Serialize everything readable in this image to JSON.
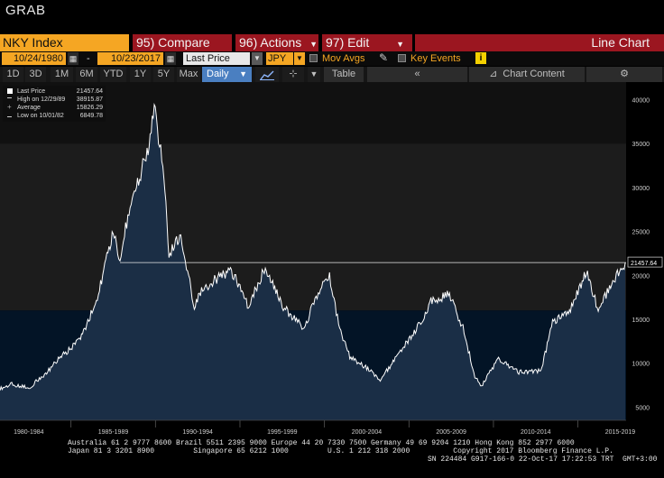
{
  "window": {
    "title": "GRAB"
  },
  "command_bar": {
    "ticker": "NKY Index",
    "compare": {
      "num": "95)",
      "label": "Compare"
    },
    "actions": {
      "num": "96)",
      "label": "Actions"
    },
    "edit": {
      "num": "97)",
      "label": "Edit"
    },
    "chart_type": "Line Chart"
  },
  "settings_bar": {
    "start_date": "10/24/1980",
    "dash": "-",
    "end_date": "10/23/2017",
    "field": "Last Price",
    "currency": "JPY",
    "mov_avgs": "Mov Avgs",
    "key_events": "Key Events",
    "info": "i"
  },
  "toolbar": {
    "periods": [
      "1D",
      "3D",
      "1M",
      "6M",
      "YTD",
      "1Y",
      "5Y",
      "Max"
    ],
    "frequency": "Daily",
    "table": "Table",
    "collapse": "«",
    "chart_content": "Chart Content",
    "settings_icon": "⚙"
  },
  "legend": {
    "items": [
      {
        "label": "Last Price",
        "value": "21457.64",
        "icon": "square"
      },
      {
        "label": "High on 12/29/89",
        "value": "38915.87",
        "icon": "high"
      },
      {
        "label": "Average",
        "value": "15826.29",
        "icon": "plus"
      },
      {
        "label": "Low on 10/01/82",
        "value": "6849.78",
        "icon": "low"
      }
    ]
  },
  "colors": {
    "accent": "#f5a623",
    "bar_red": "#9b1620",
    "series_fill": "#1b2f48",
    "line": "#ffffff"
  },
  "chart_data": {
    "type": "area",
    "title": "",
    "xlabel": "",
    "ylabel": "",
    "ylim": [
      3500,
      42000
    ],
    "yticks": [
      5000,
      10000,
      15000,
      20000,
      25000,
      30000,
      35000,
      40000
    ],
    "xtick_labels": [
      "1980-1984",
      "1985-1989",
      "1990-1994",
      "1995-1999",
      "2000-2004",
      "2005-2009",
      "2010-2014",
      "2015-2019"
    ],
    "last_price_label": "21457.64",
    "last_price": 21457.64,
    "series": [
      {
        "x": [
          1980.8,
          1981.5,
          1982.5,
          1983.5,
          1984.5,
          1985.5,
          1986.5,
          1987.5,
          1987.9,
          1988.5,
          1989.5,
          1989.99,
          1990.5,
          1990.8,
          1991.5,
          1992.3,
          1992.6,
          1993.5,
          1994.5,
          1995.5,
          1996.5,
          1997.5,
          1998.8,
          1999.5,
          2000.3,
          2000.9,
          2001.5,
          2002.5,
          2003.3,
          2004.5,
          2005.5,
          2006.3,
          2007.4,
          2008.2,
          2008.9,
          2009.3,
          2010.3,
          2011.5,
          2012.8,
          2013.5,
          2014.5,
          2015.5,
          2016.2,
          2017.0,
          2017.8
        ],
        "y": [
          7100,
          7600,
          7200,
          8800,
          10900,
          12600,
          17000,
          25000,
          22000,
          28000,
          34000,
          38900,
          31000,
          22500,
          24500,
          16500,
          18000,
          19500,
          20500,
          16500,
          21000,
          16500,
          14000,
          17500,
          20000,
          13800,
          10700,
          9500,
          8000,
          11500,
          14000,
          17000,
          17800,
          14000,
          8500,
          7400,
          10500,
          9000,
          9100,
          14600,
          15900,
          20500,
          16000,
          19000,
          21457
        ]
      }
    ]
  },
  "footer": {
    "line1": "Australia 61 2 9777 8600 Brazil 5511 2395 9000 Europe 44 20 7330 7500 Germany 49 69 9204 1210 Hong Kong 852 2977 6000",
    "line2": "Japan 81 3 3201 8900         Singapore 65 6212 1000         U.S. 1 212 318 2000          Copyright 2017 Bloomberg Finance L.P.",
    "line3": "SN 224484 G917-166-0 22-Oct-17 17:22:53 TRT  GMT+3:00"
  }
}
